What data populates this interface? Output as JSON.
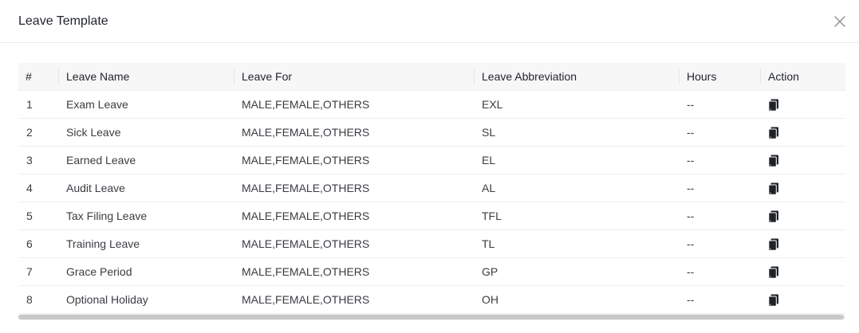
{
  "modal": {
    "title": "Leave Template",
    "close_icon": "close-icon"
  },
  "table": {
    "headers": {
      "index": "#",
      "name": "Leave Name",
      "for": "Leave For",
      "abbr": "Leave Abbreviation",
      "hours": "Hours",
      "action": "Action"
    },
    "rows": [
      {
        "index": "1",
        "name": "Exam Leave",
        "for": "MALE,FEMALE,OTHERS",
        "abbr": "EXL",
        "hours": "--",
        "action_icon": "copy-icon"
      },
      {
        "index": "2",
        "name": "Sick Leave",
        "for": "MALE,FEMALE,OTHERS",
        "abbr": "SL",
        "hours": "--",
        "action_icon": "copy-icon"
      },
      {
        "index": "3",
        "name": "Earned Leave",
        "for": "MALE,FEMALE,OTHERS",
        "abbr": "EL",
        "hours": "--",
        "action_icon": "copy-icon"
      },
      {
        "index": "4",
        "name": "Audit Leave",
        "for": "MALE,FEMALE,OTHERS",
        "abbr": "AL",
        "hours": "--",
        "action_icon": "copy-icon"
      },
      {
        "index": "5",
        "name": "Tax Filing Leave",
        "for": "MALE,FEMALE,OTHERS",
        "abbr": "TFL",
        "hours": "--",
        "action_icon": "copy-icon"
      },
      {
        "index": "6",
        "name": "Training Leave",
        "for": "MALE,FEMALE,OTHERS",
        "abbr": "TL",
        "hours": "--",
        "action_icon": "copy-icon"
      },
      {
        "index": "7",
        "name": "Grace Period",
        "for": "MALE,FEMALE,OTHERS",
        "abbr": "GP",
        "hours": "--",
        "action_icon": "copy-icon"
      },
      {
        "index": "8",
        "name": "Optional Holiday",
        "for": "MALE,FEMALE,OTHERS",
        "abbr": "OH",
        "hours": "--",
        "action_icon": "copy-icon"
      }
    ]
  },
  "colors": {
    "header_bg": "#f7f7f8",
    "text": "#1f2329",
    "icon": "#1f2329",
    "divider": "#efefef"
  }
}
